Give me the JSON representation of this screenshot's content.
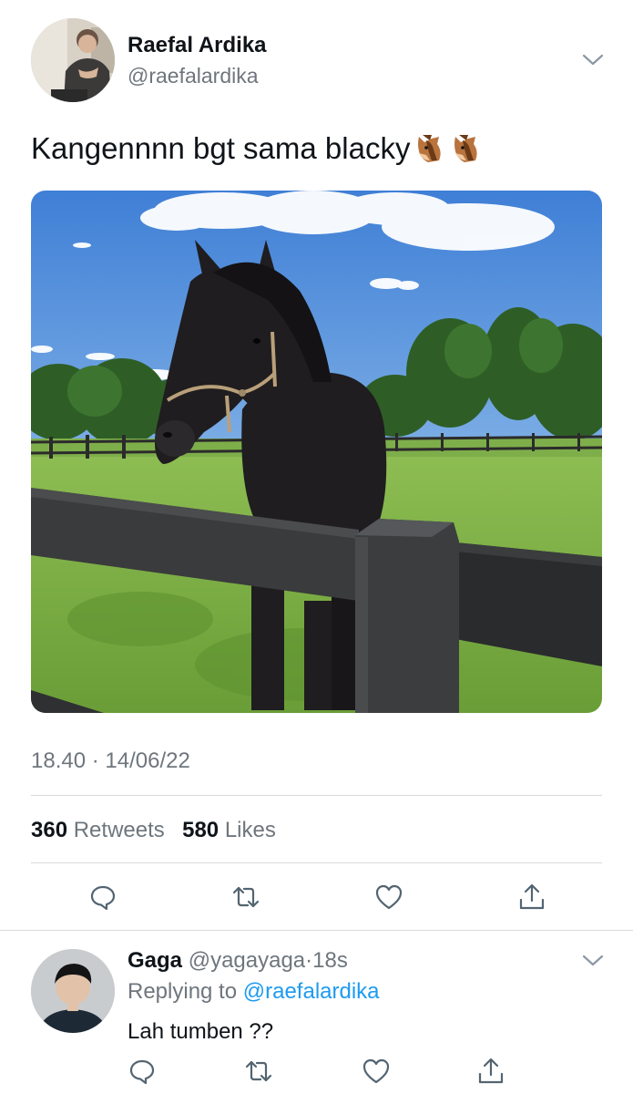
{
  "tweet": {
    "author_name": "Raefal Ardika",
    "author_handle": "@raefalardika",
    "text": "Kangennnn bgt sama blacky",
    "text_emoji": [
      "horse-face",
      "horse-face"
    ],
    "timestamp": "18.40 · 14/06/22",
    "stats": {
      "retweets_count": "360",
      "retweets_label": "Retweets",
      "likes_count": "580",
      "likes_label": "Likes"
    },
    "actions": [
      "reply-icon",
      "retweet-icon",
      "like-icon",
      "share-icon"
    ]
  },
  "reply": {
    "author_name": "Gaga",
    "author_handle": "@yagayaga",
    "separator": "·",
    "time_ago": "18s",
    "replying_prefix": "Replying to",
    "replying_to": "@raefalardika",
    "text": "Lah tumben ??",
    "actions": [
      "reply-icon",
      "retweet-icon",
      "like-icon",
      "share-icon"
    ]
  },
  "colors": {
    "text_primary": "#0f1419",
    "text_secondary": "#6e767d",
    "link": "#1d9bf0",
    "divider": "#d6dadd",
    "background": "#ffffff"
  }
}
